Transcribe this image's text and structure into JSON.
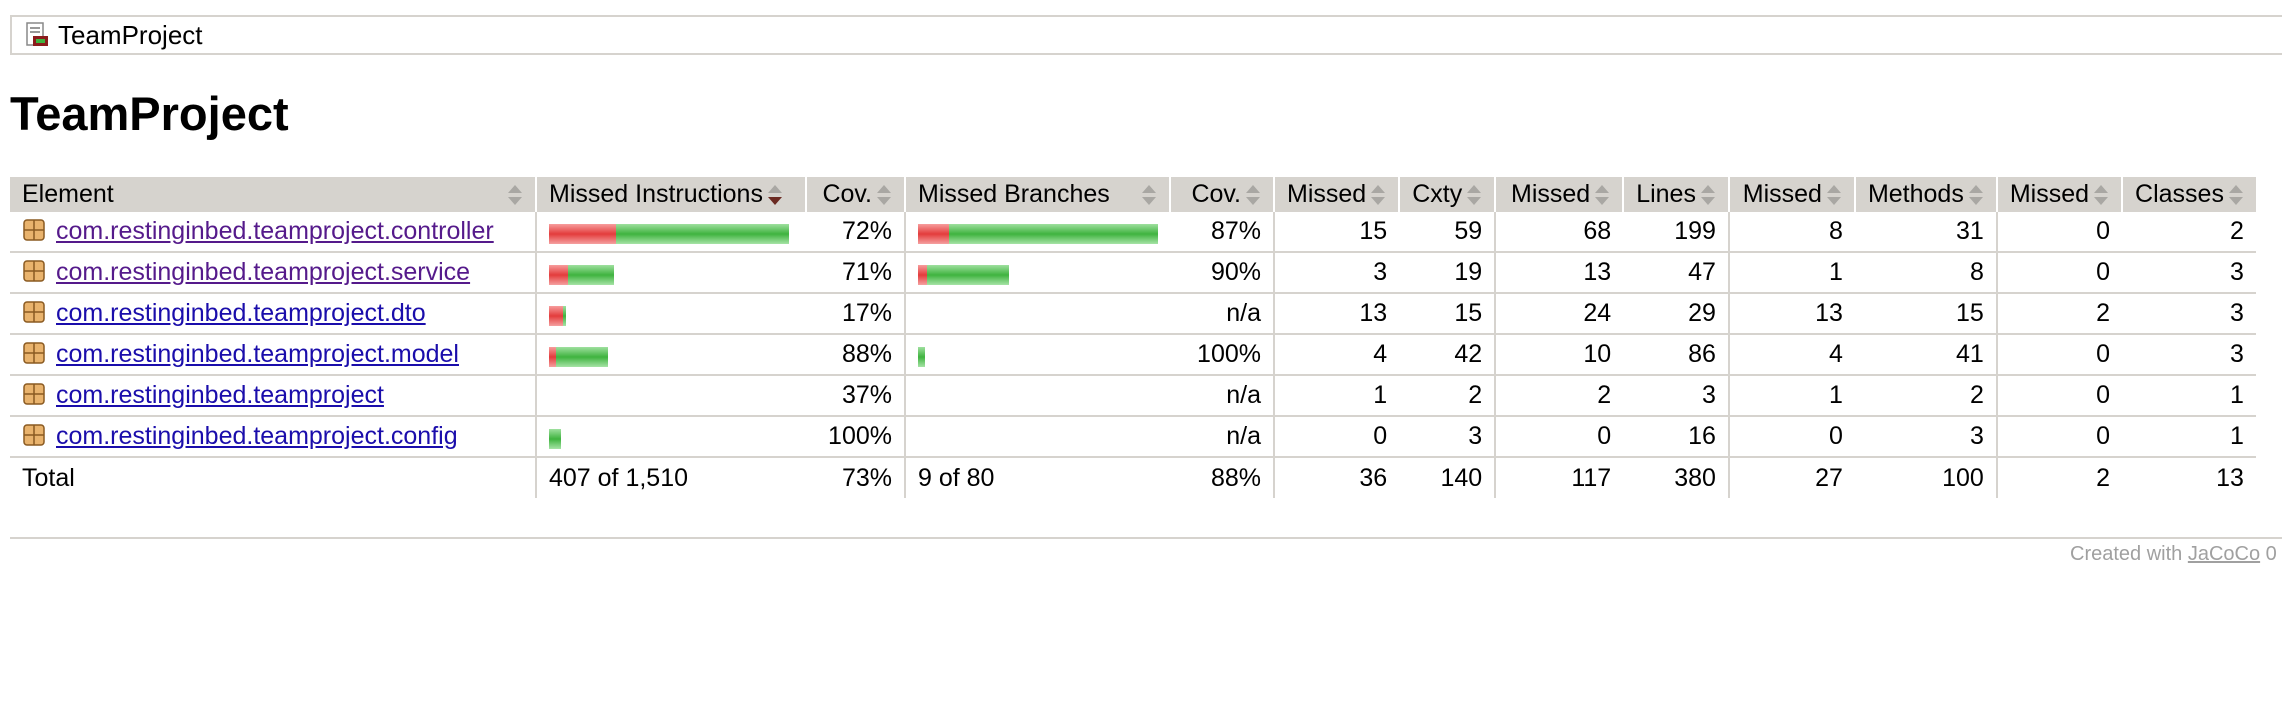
{
  "breadcrumb": {
    "label": "TeamProject",
    "icon": "report-icon"
  },
  "page_title": "TeamProject",
  "headers": {
    "element": "Element",
    "missed_instructions": "Missed Instructions",
    "cov1": "Cov.",
    "missed_branches": "Missed Branches",
    "cov2": "Cov.",
    "missed_cxty": "Missed",
    "cxty": "Cxty",
    "missed_lines": "Missed",
    "lines": "Lines",
    "missed_methods": "Missed",
    "methods": "Methods",
    "missed_classes": "Missed",
    "classes": "Classes"
  },
  "rows": [
    {
      "name": "com.restinginbed.teamproject.controller",
      "visited": true,
      "instr_cov": "72%",
      "instr_missed_frac": 0.28,
      "instr_width_frac": 1.0,
      "branch_cov": "87%",
      "branch_missed_frac": 0.13,
      "branch_width_frac": 1.0,
      "missed_cxty": "15",
      "cxty": "59",
      "missed_lines": "68",
      "lines": "199",
      "missed_methods": "8",
      "methods": "31",
      "missed_classes": "0",
      "classes": "2"
    },
    {
      "name": "com.restinginbed.teamproject.service",
      "visited": true,
      "instr_cov": "71%",
      "instr_missed_frac": 0.29,
      "instr_width_frac": 0.27,
      "branch_cov": "90%",
      "branch_missed_frac": 0.1,
      "branch_width_frac": 0.38,
      "missed_cxty": "3",
      "cxty": "19",
      "missed_lines": "13",
      "lines": "47",
      "missed_methods": "1",
      "methods": "8",
      "missed_classes": "0",
      "classes": "3"
    },
    {
      "name": "com.restinginbed.teamproject.dto",
      "visited": false,
      "instr_cov": "17%",
      "instr_missed_frac": 0.83,
      "instr_width_frac": 0.07,
      "branch_cov": "n/a",
      "branch_missed_frac": 0,
      "branch_width_frac": 0,
      "missed_cxty": "13",
      "cxty": "15",
      "missed_lines": "24",
      "lines": "29",
      "missed_methods": "13",
      "methods": "15",
      "missed_classes": "2",
      "classes": "3"
    },
    {
      "name": "com.restinginbed.teamproject.model",
      "visited": false,
      "instr_cov": "88%",
      "instr_missed_frac": 0.12,
      "instr_width_frac": 0.245,
      "branch_cov": "100%",
      "branch_missed_frac": 0,
      "branch_width_frac": 0.03,
      "missed_cxty": "4",
      "cxty": "42",
      "missed_lines": "10",
      "lines": "86",
      "missed_methods": "4",
      "methods": "41",
      "missed_classes": "0",
      "classes": "3"
    },
    {
      "name": "com.restinginbed.teamproject",
      "visited": false,
      "instr_cov": "37%",
      "instr_missed_frac": 0.63,
      "instr_width_frac": 0,
      "branch_cov": "n/a",
      "branch_missed_frac": 0,
      "branch_width_frac": 0,
      "missed_cxty": "1",
      "cxty": "2",
      "missed_lines": "2",
      "lines": "3",
      "missed_methods": "1",
      "methods": "2",
      "missed_classes": "0",
      "classes": "1"
    },
    {
      "name": "com.restinginbed.teamproject.config",
      "visited": false,
      "instr_cov": "100%",
      "instr_missed_frac": 0,
      "instr_width_frac": 0.05,
      "branch_cov": "n/a",
      "branch_missed_frac": 0,
      "branch_width_frac": 0,
      "missed_cxty": "0",
      "cxty": "3",
      "missed_lines": "0",
      "lines": "16",
      "missed_methods": "0",
      "methods": "3",
      "missed_classes": "0",
      "classes": "1"
    }
  ],
  "total": {
    "label": "Total",
    "instr": "407 of 1,510",
    "instr_cov": "73%",
    "branch": "9 of 80",
    "branch_cov": "88%",
    "missed_cxty": "36",
    "cxty": "140",
    "missed_lines": "117",
    "lines": "380",
    "missed_methods": "27",
    "methods": "100",
    "missed_classes": "2",
    "classes": "13"
  },
  "footer": {
    "prefix": "Created with",
    "link": "JaCoCo",
    "suffix": " 0"
  },
  "colors": {
    "missed": "#e33c3c",
    "covered": "#3fb33f",
    "header_bg": "#d6d3ce"
  }
}
